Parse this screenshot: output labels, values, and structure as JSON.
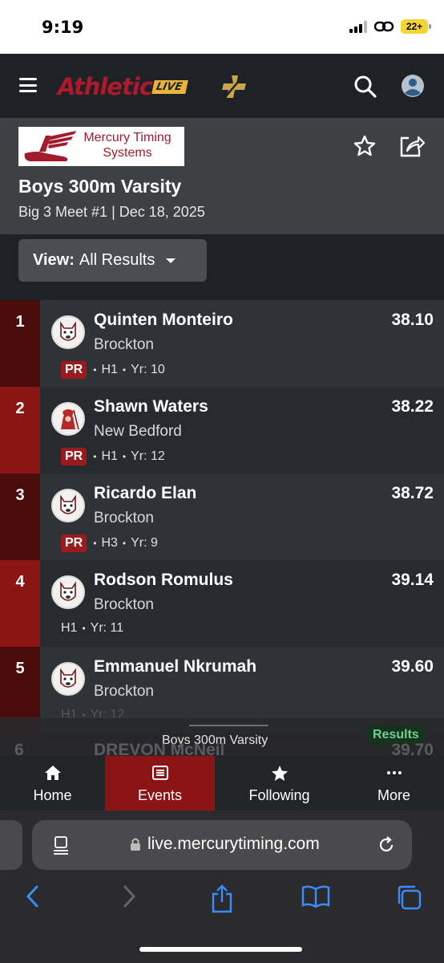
{
  "status_bar": {
    "time": "9:19",
    "battery": "22+"
  },
  "app": {
    "logo_text": "Athletic",
    "logo_badge": "LIVE"
  },
  "event": {
    "sponsor_line1": "Mercury Timing",
    "sponsor_line2": "Systems",
    "title": "Boys 300m Varsity",
    "subtitle": "Big 3 Meet #1 | Dec 18, 2025"
  },
  "filter": {
    "label": "View:",
    "value": "All Results"
  },
  "results": [
    {
      "place": "1",
      "name": "Quinten Monteiro",
      "team": "Brockton",
      "mark": "38.10",
      "pr": "PR",
      "heat": "H1",
      "year": "Yr: 10"
    },
    {
      "place": "2",
      "name": "Shawn Waters",
      "team": "New Bedford",
      "mark": "38.22",
      "pr": "PR",
      "heat": "H1",
      "year": "Yr: 12"
    },
    {
      "place": "3",
      "name": "Ricardo Elan",
      "team": "Brockton",
      "mark": "38.72",
      "pr": "PR",
      "heat": "H3",
      "year": "Yr: 9"
    },
    {
      "place": "4",
      "name": "Rodson Romulus",
      "team": "Brockton",
      "mark": "39.14",
      "pr": "",
      "heat": "H1",
      "year": "Yr: 11"
    },
    {
      "place": "5",
      "name": "Emmanuel Nkrumah",
      "team": "Brockton",
      "mark": "39.60",
      "pr": "",
      "heat": "H1",
      "year": "Yr: 12"
    }
  ],
  "peek_row": {
    "place": "6",
    "name": "DREVON McNeil",
    "mark": "39.70"
  },
  "now_bar": {
    "title": "Boys 300m Varsity",
    "badge": "Results"
  },
  "tabs": [
    {
      "label": "Home",
      "icon": "home-icon",
      "active": false
    },
    {
      "label": "Events",
      "icon": "list-icon",
      "active": true
    },
    {
      "label": "Following",
      "icon": "star-icon",
      "active": false
    },
    {
      "label": "More",
      "icon": "more-icon",
      "active": false
    }
  ],
  "browser": {
    "url": "live.mercurytiming.com"
  },
  "colors": {
    "brand_red": "#8c1414",
    "place_dark": "#4a0b0b",
    "place_bright": "#8a1512",
    "pr_red": "#9c1a1c"
  }
}
